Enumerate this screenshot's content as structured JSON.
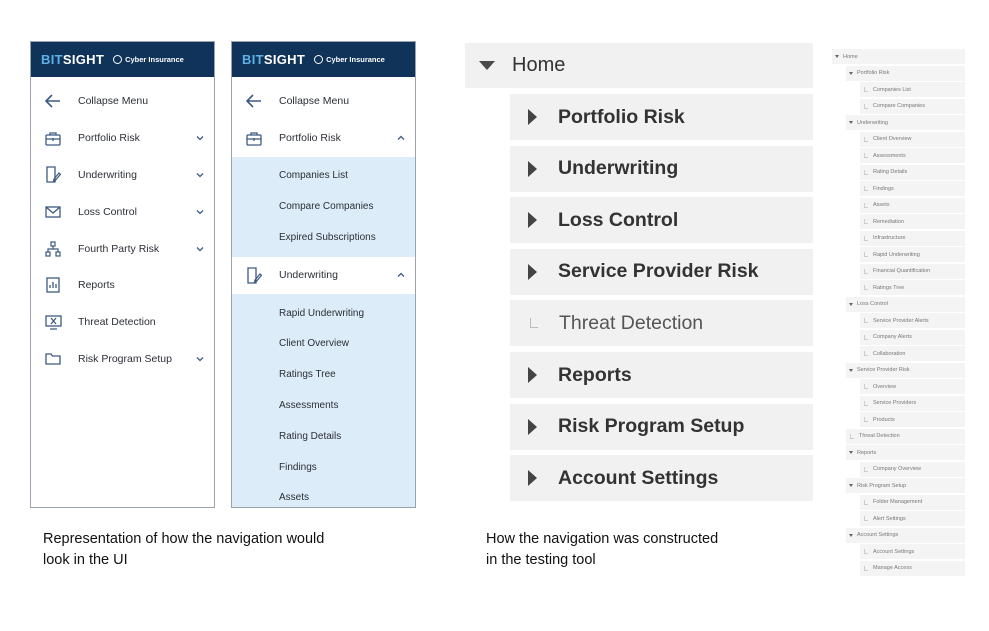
{
  "ui_panel_1": {
    "brand": {
      "bit": "BIT",
      "sight": "SIGHT",
      "product": "Cyber Insurance"
    },
    "items": [
      {
        "label": "Collapse Menu",
        "icon": "arrow-left-icon",
        "chevron": false
      },
      {
        "label": "Portfolio Risk",
        "icon": "briefcase-icon",
        "chevron": true
      },
      {
        "label": "Underwriting",
        "icon": "document-edit-icon",
        "chevron": true
      },
      {
        "label": "Loss Control",
        "icon": "envelope-icon",
        "chevron": true
      },
      {
        "label": "Fourth Party Risk",
        "icon": "hierarchy-icon",
        "chevron": true
      },
      {
        "label": "Reports",
        "icon": "report-icon",
        "chevron": false
      },
      {
        "label": "Threat Detection",
        "icon": "threat-icon",
        "chevron": false
      },
      {
        "label": "Risk Program Setup",
        "icon": "folder-icon",
        "chevron": true
      }
    ]
  },
  "ui_panel_2": {
    "brand": {
      "bit": "BIT",
      "sight": "SIGHT",
      "product": "Cyber Insurance"
    },
    "items": [
      {
        "label": "Collapse Menu",
        "icon": "arrow-left-icon"
      },
      {
        "label": "Portfolio Risk",
        "icon": "briefcase-icon"
      },
      {
        "label": "Underwriting",
        "icon": "document-edit-icon"
      }
    ],
    "portfolio_sub": [
      "Companies List",
      "Compare Companies",
      "Expired Subscriptions"
    ],
    "underwriting_sub": [
      "Rapid Underwriting",
      "Client Overview",
      "Ratings Tree",
      "Assessments",
      "Rating Details",
      "Findings",
      "Assets"
    ]
  },
  "testing_tool": {
    "home": "Home",
    "items": [
      {
        "label": "Portfolio Risk",
        "expandable": true
      },
      {
        "label": "Underwriting",
        "expandable": true
      },
      {
        "label": "Loss Control",
        "expandable": true
      },
      {
        "label": "Service Provider Risk",
        "expandable": true
      },
      {
        "label": "Threat Detection",
        "expandable": false
      },
      {
        "label": "Reports",
        "expandable": true
      },
      {
        "label": "Risk Program Setup",
        "expandable": true
      },
      {
        "label": "Account Settings",
        "expandable": true
      }
    ]
  },
  "mini_tree": [
    {
      "label": "Home",
      "level": 0,
      "expanded": true
    },
    {
      "label": "Portfolio Risk",
      "level": 1,
      "expanded": true
    },
    {
      "label": "Companies List",
      "level": 2
    },
    {
      "label": "Compare Companies",
      "level": 2
    },
    {
      "label": "Underwriting",
      "level": 1,
      "expanded": true
    },
    {
      "label": "Client Overview",
      "level": 2
    },
    {
      "label": "Assessments",
      "level": 2
    },
    {
      "label": "Rating Details",
      "level": 2
    },
    {
      "label": "Findings",
      "level": 2
    },
    {
      "label": "Assets",
      "level": 2
    },
    {
      "label": "Remediation",
      "level": 2
    },
    {
      "label": "Infrastructure",
      "level": 2
    },
    {
      "label": "Rapid Underwriting",
      "level": 2
    },
    {
      "label": "Financial Quantification",
      "level": 2
    },
    {
      "label": "Ratings Tree",
      "level": 2
    },
    {
      "label": "Loss Control",
      "level": 1,
      "expanded": true
    },
    {
      "label": "Service Provider Alerts",
      "level": 2
    },
    {
      "label": "Company Alerts",
      "level": 2
    },
    {
      "label": "Collaboration",
      "level": 2
    },
    {
      "label": "Service Provider Risk",
      "level": 1,
      "expanded": true
    },
    {
      "label": "Overview",
      "level": 2
    },
    {
      "label": "Service Providers",
      "level": 2
    },
    {
      "label": "Products",
      "level": 2
    },
    {
      "label": "Threat Detection",
      "level": 1,
      "expanded": false
    },
    {
      "label": "Reports",
      "level": 1,
      "expanded": true
    },
    {
      "label": "Company Overview",
      "level": 2
    },
    {
      "label": "Risk Program Setup",
      "level": 1,
      "expanded": true
    },
    {
      "label": "Folder Management",
      "level": 2
    },
    {
      "label": "Alert Settings",
      "level": 2
    },
    {
      "label": "Account Settings",
      "level": 1,
      "expanded": true
    },
    {
      "label": "Account Settings",
      "level": 2
    },
    {
      "label": "Manage Access",
      "level": 2
    }
  ],
  "captions": {
    "left_line1": "Representation of how the navigation would",
    "left_line2": "look in the UI",
    "right_line1": "How the navigation was constructed",
    "right_line2": "in the testing tool"
  }
}
